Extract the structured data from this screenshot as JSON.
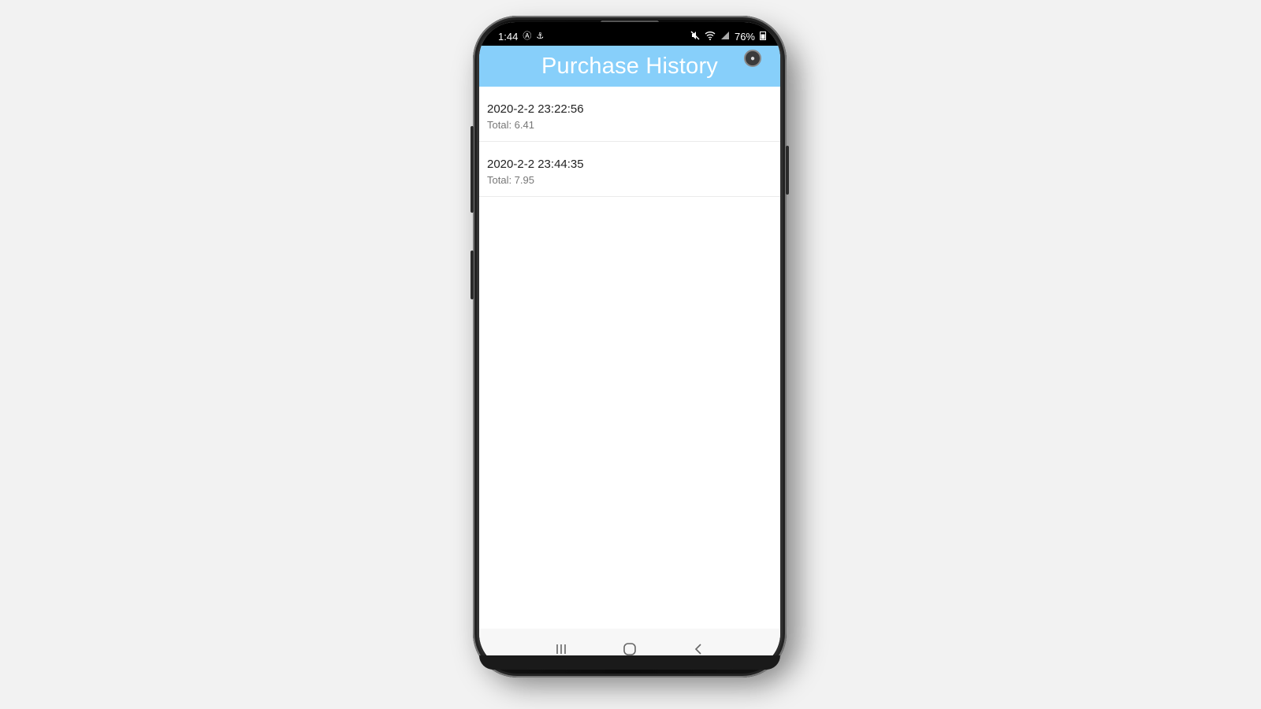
{
  "status_bar": {
    "time": "1:44",
    "battery": "76%",
    "left_icons": [
      "a-icon",
      "usb-icon"
    ],
    "right_icons": [
      "mute-icon",
      "wifi-icon",
      "signal-icon",
      "battery-icon"
    ]
  },
  "header": {
    "title": "Purchase History",
    "bg_color": "#87cffa"
  },
  "purchases": [
    {
      "date": "2020-2-2 23:22:56",
      "total": "Total: 6.41"
    },
    {
      "date": "2020-2-2 23:44:35",
      "total": "Total: 7.95"
    }
  ],
  "nav_bar": {
    "buttons": [
      "recents-icon",
      "home-icon",
      "back-icon"
    ]
  }
}
